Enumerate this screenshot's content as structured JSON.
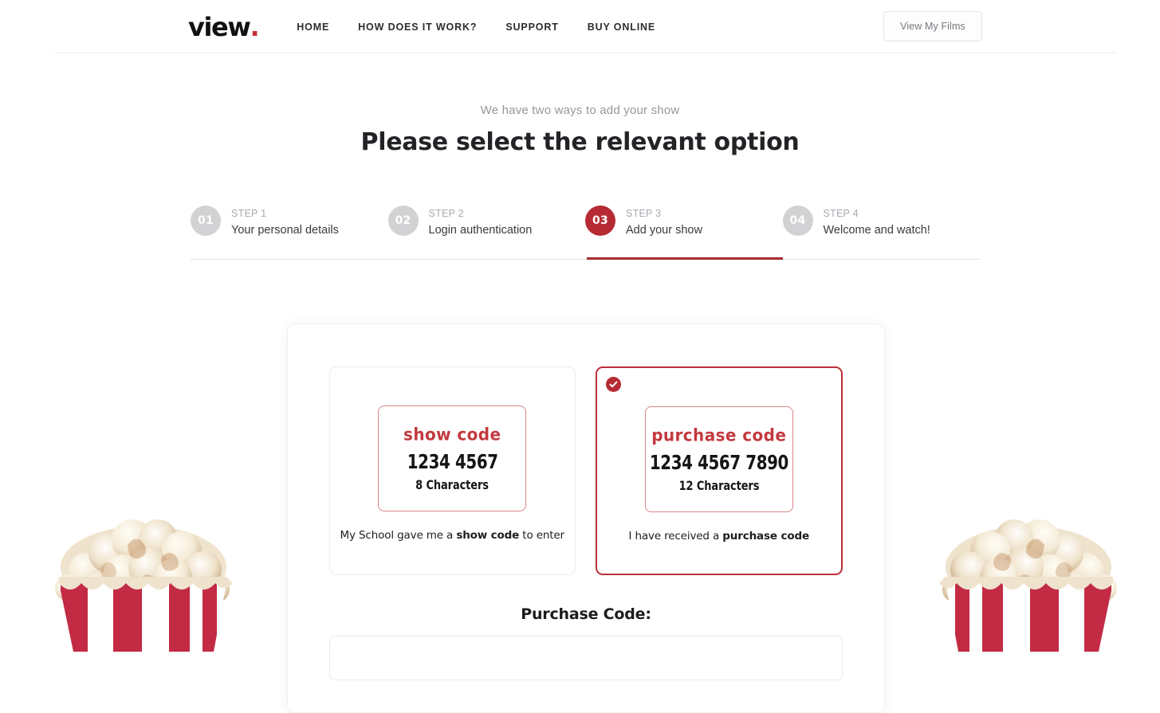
{
  "header": {
    "brand_text": "view",
    "brand_dot": ".",
    "nav": [
      {
        "label": "HOME"
      },
      {
        "label": "HOW DOES IT WORK?"
      },
      {
        "label": "SUPPORT"
      },
      {
        "label": "BUY ONLINE"
      }
    ],
    "films_button": "View My Films"
  },
  "hero": {
    "kicker": "We have two ways to add your show",
    "title": "Please select the relevant option"
  },
  "stepper": {
    "steps": [
      {
        "number": "01",
        "label": "STEP 1",
        "name": "Your personal details",
        "active": false
      },
      {
        "number": "02",
        "label": "STEP 2",
        "name": "Login authentication",
        "active": false
      },
      {
        "number": "03",
        "label": "STEP 3",
        "name": "Add your show",
        "active": true
      },
      {
        "number": "04",
        "label": "STEP 4",
        "name": "Welcome and watch!",
        "active": false
      }
    ]
  },
  "options": [
    {
      "code_title": "show code",
      "code_sample": "1234 4567",
      "code_count": "8 Characters",
      "caption_pre": "My School gave me a ",
      "caption_strong": "show code",
      "caption_post": " to enter",
      "selected": false
    },
    {
      "code_title": "purchase code",
      "code_sample": "1234 4567 7890",
      "code_count": "12 Characters",
      "caption_pre": "I have received a ",
      "caption_strong": "purchase code",
      "caption_post": "",
      "selected": true
    }
  ],
  "field": {
    "label": "Purchase Code:",
    "value": "",
    "placeholder": ""
  },
  "colors": {
    "brand_red": "#b62b33",
    "accent_red": "#c23a3f",
    "text_dark": "#232327",
    "muted": "#97979e"
  },
  "decor": {
    "left_popcorn": "popcorn-bucket-image",
    "right_popcorn": "popcorn-bucket-image"
  }
}
